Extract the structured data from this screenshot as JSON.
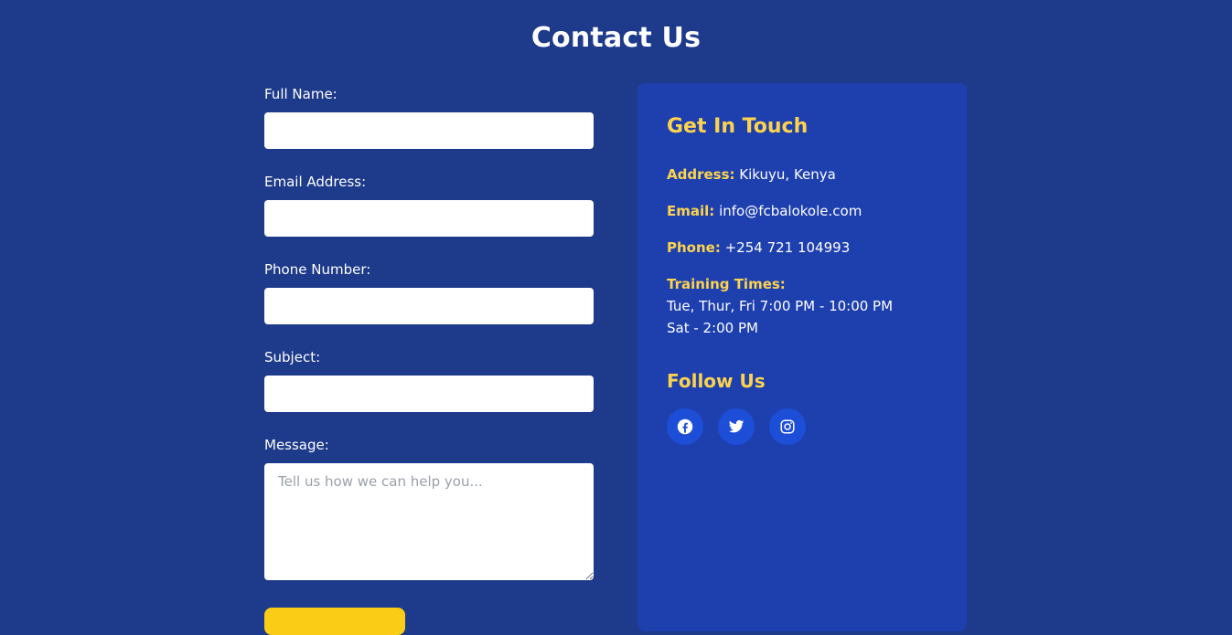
{
  "page": {
    "title": "Contact Us"
  },
  "form": {
    "full_name_label": "Full Name:",
    "email_label": "Email Address:",
    "phone_label": "Phone Number:",
    "subject_label": "Subject:",
    "message_label": "Message:",
    "message_placeholder": "Tell us how we can help you...",
    "full_name_value": "",
    "email_value": "",
    "phone_value": "",
    "subject_value": ""
  },
  "contact": {
    "heading": "Get In Touch",
    "address_key": "Address:",
    "address_value": "Kikuyu, Kenya",
    "email_key": "Email:",
    "email_value": "info@fcbalokole.com",
    "phone_key": "Phone:",
    "phone_value": "+254 721 104993",
    "training_key": "Training Times:",
    "training_line_1": "Tue, Thur, Fri 7:00 PM - 10:00 PM",
    "training_line_2": "Sat - 2:00 PM"
  },
  "social": {
    "heading": "Follow Us",
    "icons": [
      "facebook-icon",
      "twitter-icon",
      "instagram-icon"
    ]
  },
  "colors": {
    "page_background": "#1e3a8a",
    "panel_background": "#1e40af",
    "accent_yellow": "#fcd34d",
    "button_yellow": "#facc15",
    "social_circle": "#1d4ed8"
  }
}
